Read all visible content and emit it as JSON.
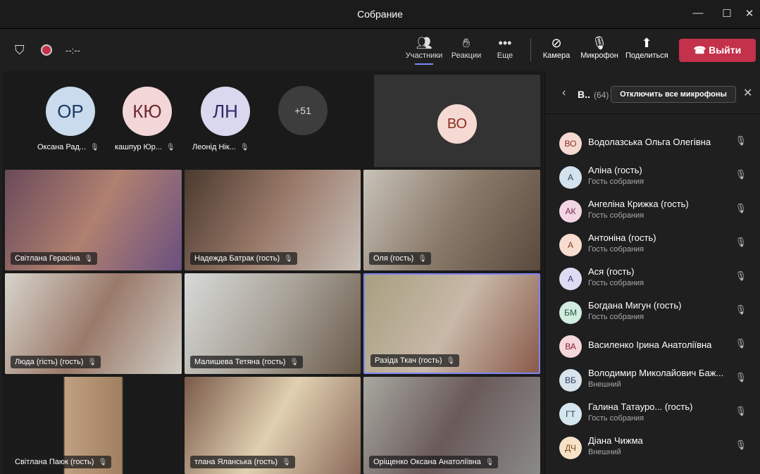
{
  "window": {
    "title": "Собрание",
    "minimize": "—",
    "maximize": "☐",
    "close": "✕"
  },
  "toolbar": {
    "timer": "--:--",
    "participants": "Участники",
    "reactions": "Реакции",
    "more": "Еще",
    "camera": "Камера",
    "mic": "Микрофон",
    "share": "Поделиться",
    "leave": "Выйти"
  },
  "top_avatars": [
    {
      "initials": "ОР",
      "name": "Оксана Рад...",
      "bg": "#c9dbed",
      "fg": "#1b3a66"
    },
    {
      "initials": "КЮ",
      "name": "кашпур Юр...",
      "bg": "#f3d6d8",
      "fg": "#6b2a30"
    },
    {
      "initials": "ЛН",
      "name": "Леонід Нік...",
      "bg": "#dad8ee",
      "fg": "#2f2a6b"
    }
  ],
  "overflow": "+51",
  "featured": {
    "initials": "ВО"
  },
  "tiles": [
    {
      "name": "Світлана Герасіна"
    },
    {
      "name": "Надежда Батрак (гость)"
    },
    {
      "name": "Оля (гость)"
    },
    {
      "name": "Люда (гість) (гость)"
    },
    {
      "name": "Малишева Тетяна (гость)"
    },
    {
      "name": "Разіда Ткач (гость)"
    },
    {
      "name": "Світлана Паюк (гость)"
    },
    {
      "name": "тлана Яланська (гость)"
    },
    {
      "name": "Оріщенко Оксана Анатоліївна"
    }
  ],
  "panel": {
    "title": "В..",
    "count": "(64)",
    "mute_all": "Отключить все микрофоны",
    "participants": [
      {
        "initials": "ВО",
        "name": "Водолазська Ольга Олегівна",
        "sub": "",
        "bg": "#f6d9d3",
        "fg": "#8a2e1e"
      },
      {
        "initials": "А",
        "name": "Аліна (гость)",
        "sub": "Гость собрания",
        "bg": "#d4e2ee",
        "fg": "#29415c"
      },
      {
        "initials": "АК",
        "name": "Ангеліна Крижка (гость)",
        "sub": "Гость собрания",
        "bg": "#f3d6e4",
        "fg": "#7a2a50"
      },
      {
        "initials": "А",
        "name": "Антоніна (гость)",
        "sub": "Гость собрания",
        "bg": "#f7dccf",
        "fg": "#8a3a1e"
      },
      {
        "initials": "А",
        "name": "Ася (гость)",
        "sub": "Гость собрания",
        "bg": "#dcdcf2",
        "fg": "#33337a"
      },
      {
        "initials": "БМ",
        "name": "Богдана Мигун (гость)",
        "sub": "Гость собрания",
        "bg": "#d2ecdf",
        "fg": "#1e5a3c"
      },
      {
        "initials": "ВА",
        "name": "Василенко Ірина Анатоліївна",
        "sub": "",
        "bg": "#f5d6da",
        "fg": "#8a1e2e"
      },
      {
        "initials": "ВБ",
        "name": "Володимир Миколайович Баж...",
        "sub": "Внешний",
        "bg": "#d8e3ec",
        "fg": "#29415c"
      },
      {
        "initials": "ГТ",
        "name": "Галина Татауро...  (гость)",
        "sub": "Гость собрания",
        "bg": "#d6e6ef",
        "fg": "#29415c"
      },
      {
        "initials": "ДЧ",
        "name": "Діана Чижма",
        "sub": "Внешний",
        "bg": "#f7e2c8",
        "fg": "#7a4a1e"
      }
    ]
  }
}
